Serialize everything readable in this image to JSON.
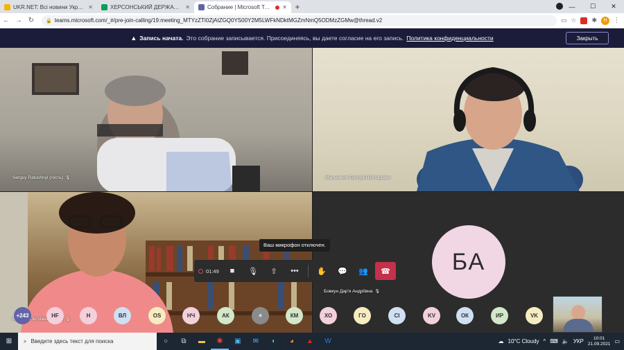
{
  "browser": {
    "tabs": [
      {
        "title": "UKR.NET: Всі новини України, о",
        "fav_color": "#f4b400"
      },
      {
        "title": "ХЕРСОНСЬКИЙ ДЕРЖАВНИЙ",
        "fav_color": "#0f9d58"
      },
      {
        "title": "Собрание | Microsoft Teams",
        "fav_color": "#6264a7",
        "active": true
      }
    ],
    "url": "teams.microsoft.com/_#/pre-join-calling/19:meeting_MTYzZTI0ZjAtZGQ0YS00Y2M5LWFkNDktMGZmNmQ5ODMzZGMw@thread.v2",
    "profile_initial": "Н"
  },
  "banner": {
    "title": "Запись начата.",
    "message": "Это собрание записывается. Присоединяясь, вы даете согласие на его запись.",
    "link": "Политика конфиденциальности",
    "close_label": "Закрыть"
  },
  "tiles": [
    {
      "name": "Serguy Ratushnyi (гость)"
    },
    {
      "name": "Мельников Григорій Вікторович"
    },
    {
      "name": "Марина Петрівна Ярова"
    },
    {
      "name": "Бовкун Дар'я Андріївна",
      "initials": "БА"
    }
  ],
  "call": {
    "timer": "01:49",
    "tooltip": "Ваш микрофон отключен."
  },
  "participants": [
    {
      "label": "+243",
      "color": "#6264a7"
    },
    {
      "label": "HF",
      "color": "#f3d0dc"
    },
    {
      "label": "Н",
      "color": "#f3d0dc"
    },
    {
      "label": "ВЛ",
      "color": "#cfe0f3"
    },
    {
      "label": "OS",
      "color": "#f7ecc0"
    },
    {
      "label": "НЧ",
      "color": "#f3d0dc"
    },
    {
      "label": "АК",
      "color": "#d3e7c9"
    },
    {
      "label": "",
      "color": "#8a8a8a",
      "icon": "person"
    },
    {
      "label": "КМ",
      "color": "#d3e7c9"
    },
    {
      "label": "ХО",
      "color": "#f3d0dc"
    },
    {
      "label": "ГО",
      "color": "#f7ecc0"
    },
    {
      "label": "CI",
      "color": "#cfe0f3"
    },
    {
      "label": "KV",
      "color": "#f3d0dc"
    },
    {
      "label": "ОК",
      "color": "#cfe0f3"
    },
    {
      "label": "ИР",
      "color": "#d3e7c9"
    },
    {
      "label": "VK",
      "color": "#f7ecc0"
    }
  ],
  "taskbar": {
    "search_placeholder": "Введите здесь текст для поиска",
    "weather": "10°C Cloudy",
    "lang": "УКР",
    "time": "10:01",
    "date": "21.09.2021"
  }
}
